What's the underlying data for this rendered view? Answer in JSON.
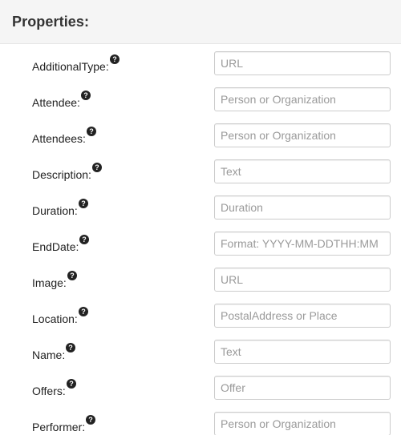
{
  "header": {
    "title": "Properties:"
  },
  "help_icon": {
    "glyph": "?",
    "icon": "question-circle-icon"
  },
  "properties": [
    {
      "label": "AdditionalType:",
      "placeholder": "URL",
      "value": ""
    },
    {
      "label": "Attendee:",
      "placeholder": "Person or Organization",
      "value": ""
    },
    {
      "label": "Attendees:",
      "placeholder": "Person or Organization",
      "value": ""
    },
    {
      "label": "Description:",
      "placeholder": "Text",
      "value": ""
    },
    {
      "label": "Duration:",
      "placeholder": "Duration",
      "value": ""
    },
    {
      "label": "EndDate:",
      "placeholder": "Format: YYYY-MM-DDTHH:MM",
      "value": ""
    },
    {
      "label": "Image:",
      "placeholder": "URL",
      "value": ""
    },
    {
      "label": "Location:",
      "placeholder": "PostalAddress or Place",
      "value": ""
    },
    {
      "label": "Name:",
      "placeholder": "Text",
      "value": ""
    },
    {
      "label": "Offers:",
      "placeholder": "Offer",
      "value": ""
    },
    {
      "label": "Performer:",
      "placeholder": "Person or Organization",
      "value": ""
    }
  ]
}
